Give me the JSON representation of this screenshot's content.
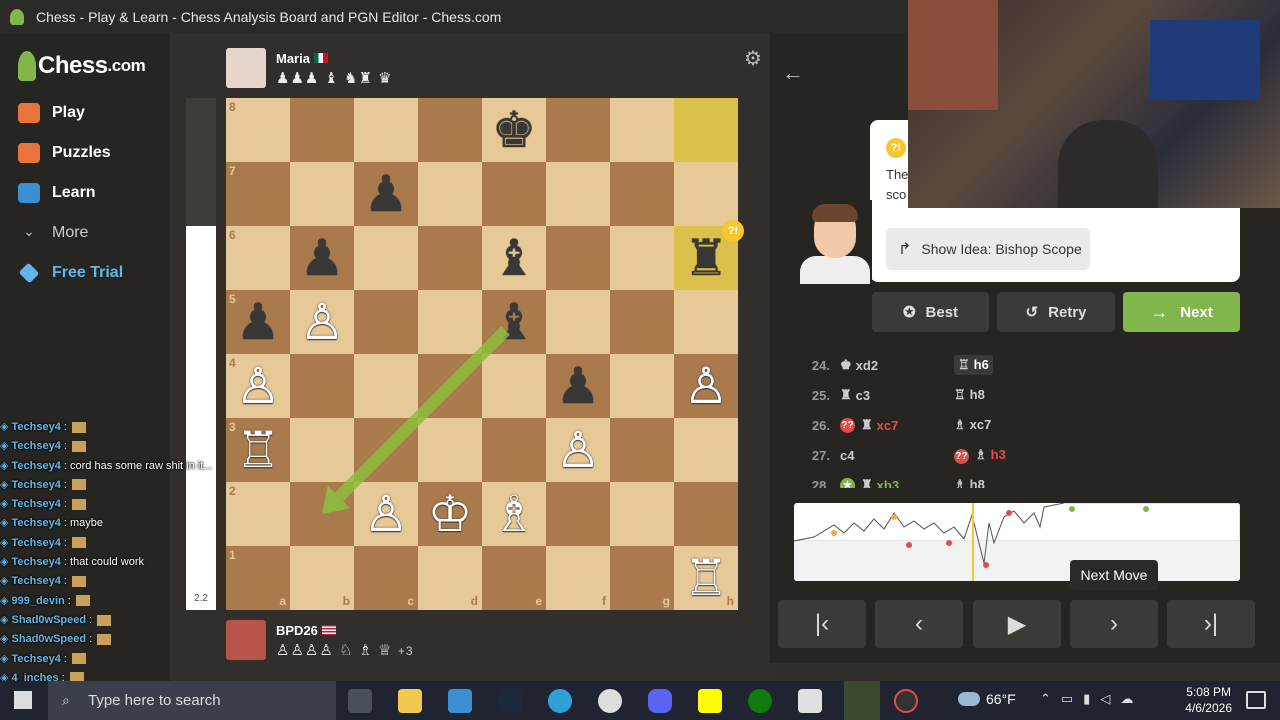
{
  "window": {
    "title": "Chess - Play & Learn - Chess Analysis Board and PGN Editor - Chess.com"
  },
  "brand": {
    "name": "Chess",
    "suffix": ".com"
  },
  "nav": {
    "items": [
      {
        "label": "Play",
        "color": "#e8743b"
      },
      {
        "label": "Puzzles",
        "color": "#e8743b"
      },
      {
        "label": "Learn",
        "color": "#3b8ed0"
      },
      {
        "label": "More",
        "color": "#bbbbbb"
      },
      {
        "label": "Free Trial",
        "color": "#62b7e9"
      }
    ]
  },
  "top_player": {
    "name": "Maria",
    "captured": "♟♟♟ ♝ ♞♜ ♛"
  },
  "bottom_player": {
    "name": "BPD26",
    "captured": "♙♙♙♙ ♘ ♗ ♕ ",
    "extra": "+3"
  },
  "eval": {
    "value": "2.2",
    "white_fraction": 0.75
  },
  "board": {
    "files": [
      "a",
      "b",
      "c",
      "d",
      "e",
      "f",
      "g",
      "h"
    ],
    "ranks": [
      "8",
      "7",
      "6",
      "5",
      "4",
      "3",
      "2",
      "1"
    ],
    "highlight": [
      "h8",
      "h6"
    ],
    "pieces": [
      {
        "sq": "e8",
        "g": "♚",
        "c": "b"
      },
      {
        "sq": "c7",
        "g": "♟",
        "c": "b"
      },
      {
        "sq": "b6",
        "g": "♟",
        "c": "b"
      },
      {
        "sq": "e6",
        "g": "♝",
        "c": "b"
      },
      {
        "sq": "h6",
        "g": "♜",
        "c": "b"
      },
      {
        "sq": "a5",
        "g": "♟",
        "c": "b"
      },
      {
        "sq": "b5",
        "g": "♙",
        "c": "w"
      },
      {
        "sq": "e5",
        "g": "♝",
        "c": "b"
      },
      {
        "sq": "a4",
        "g": "♙",
        "c": "w"
      },
      {
        "sq": "f4",
        "g": "♟",
        "c": "b"
      },
      {
        "sq": "h4",
        "g": "♙",
        "c": "w"
      },
      {
        "sq": "a3",
        "g": "♖",
        "c": "w"
      },
      {
        "sq": "f3",
        "g": "♙",
        "c": "w"
      },
      {
        "sq": "c2",
        "g": "♙",
        "c": "w"
      },
      {
        "sq": "d2",
        "g": "♔",
        "c": "w"
      },
      {
        "sq": "e2",
        "g": "♗",
        "c": "w"
      },
      {
        "sq": "h1",
        "g": "♖",
        "c": "w"
      }
    ],
    "arrow": {
      "from": "e5",
      "to": "b2",
      "color": "#8cbf3f"
    },
    "badge_square": "h6"
  },
  "coach": {
    "text_line1": "The",
    "text_line2": "sco",
    "idea_button": "Show Idea: Bishop Scope"
  },
  "buttons": {
    "best": "Best",
    "retry": "Retry",
    "next": "Next"
  },
  "moves": [
    {
      "n": "24.",
      "w": "xd2",
      "wp": "♚",
      "b": "h6",
      "bp": "♖",
      "bactive": true
    },
    {
      "n": "25.",
      "w": "c3",
      "wp": "♜",
      "b": "h8",
      "bp": "♖"
    },
    {
      "n": "26.",
      "w": "xc7",
      "wp": "♜",
      "wflag": "??",
      "wclass": "red",
      "b": "xc7",
      "bp": "♗"
    },
    {
      "n": "27.",
      "w": "c4",
      "wp": "",
      "b": "h3",
      "bp": "♗",
      "bflag": "??",
      "bclass": "red"
    },
    {
      "n": "28.",
      "w": "xb3",
      "wp": "♜",
      "wflag": "★",
      "wclass": "green",
      "b": "h8",
      "bp": "♗"
    }
  ],
  "tooltip": "Next Move",
  "controls": [
    "first-move",
    "previous-move",
    "play",
    "next-move",
    "last-move"
  ],
  "chat": [
    {
      "user": "Techsey4",
      "msg": ""
    },
    {
      "user": "Techsey4",
      "msg": ""
    },
    {
      "user": "Techsey4",
      "msg": "cord has some raw shit in it..."
    },
    {
      "user": "Techsey4",
      "msg": ""
    },
    {
      "user": "Techsey4",
      "msg": ""
    },
    {
      "user": "Techsey4",
      "msg": "maybe"
    },
    {
      "user": "Techsey4",
      "msg": ""
    },
    {
      "user": "Techsey4",
      "msg": "that could work"
    },
    {
      "user": "Techsey4",
      "msg": ""
    },
    {
      "user": "999_devin",
      "msg": ""
    },
    {
      "user": "Shad0wSpeed",
      "msg": ""
    },
    {
      "user": "Shad0wSpeed",
      "msg": ""
    },
    {
      "user": "Techsey4",
      "msg": ""
    },
    {
      "user": "4_inches",
      "msg": ""
    },
    {
      "user": "999_devin",
      "msg": ""
    }
  ],
  "taskbar": {
    "search_placeholder": "Type here to search",
    "weather": "66°F",
    "time": "5:08 PM",
    "date": "4/6/2026"
  }
}
